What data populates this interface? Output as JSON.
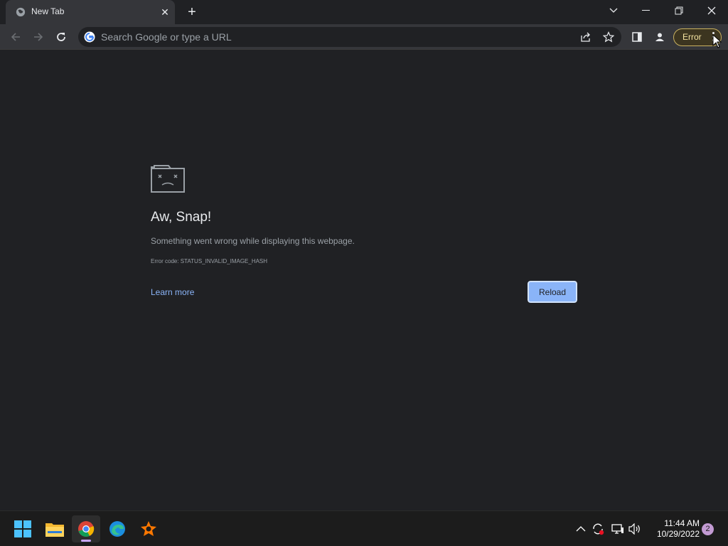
{
  "browser": {
    "tab": {
      "title": "New Tab",
      "close_glyph": "✕"
    },
    "new_tab_glyph": "+",
    "omnibox": {
      "placeholder": "Search Google or type a URL"
    },
    "error_chip": {
      "label": "Error"
    }
  },
  "crash_page": {
    "headline": "Aw, Snap!",
    "description": "Something went wrong while displaying this webpage.",
    "error_code": "Error code: STATUS_INVALID_IMAGE_HASH",
    "learn_more": "Learn more",
    "reload": "Reload"
  },
  "taskbar": {
    "apps": [
      "start-icon",
      "file-explorer-icon",
      "chrome-icon",
      "edge-icon",
      "avast-icon"
    ],
    "tray": [
      "chevron-up-icon",
      "sync-icon",
      "network-icon",
      "volume-icon"
    ],
    "time": "11:44 AM",
    "date": "10/29/2022",
    "notification_count": "2"
  },
  "colors": {
    "page_bg": "#202124",
    "toolbar_bg": "#35363a",
    "link": "#8ab4f8",
    "button": "#8ab4f8",
    "chip_border": "#c9b15f"
  }
}
